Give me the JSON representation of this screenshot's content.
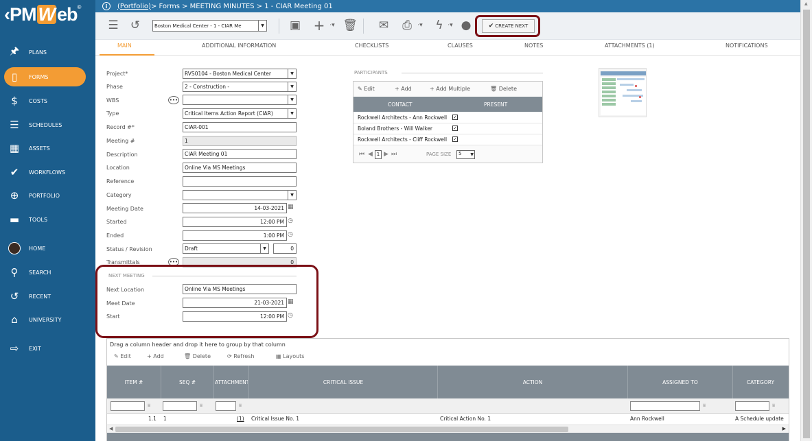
{
  "logo": {
    "text_pm": "PM",
    "text_w": "W",
    "text_eb": "eb",
    "reg": "®"
  },
  "sidebar": {
    "items": [
      {
        "label": "PLANS",
        "icon": "plans-icon",
        "glyph": "🖈"
      },
      {
        "label": "FORMS",
        "icon": "forms-icon",
        "glyph": "▯"
      },
      {
        "label": "COSTS",
        "icon": "dollar-icon",
        "glyph": "$"
      },
      {
        "label": "SCHEDULES",
        "icon": "schedules-icon",
        "glyph": "☰"
      },
      {
        "label": "ASSETS",
        "icon": "assets-icon",
        "glyph": "▦"
      },
      {
        "label": "WORKFLOWS",
        "icon": "check-icon",
        "glyph": "✔"
      },
      {
        "label": "PORTFOLIO",
        "icon": "globe-icon",
        "glyph": "⊕"
      },
      {
        "label": "TOOLS",
        "icon": "toolbox-icon",
        "glyph": "▬"
      },
      {
        "label": "HOME",
        "icon": "avatar-icon",
        "glyph": ""
      },
      {
        "label": "SEARCH",
        "icon": "search-icon",
        "glyph": "⚲"
      },
      {
        "label": "RECENT",
        "icon": "history-icon",
        "glyph": "↺"
      },
      {
        "label": "UNIVERSITY",
        "icon": "graduation-cap-icon",
        "glyph": "⌂"
      },
      {
        "label": "EXIT",
        "icon": "exit-icon",
        "glyph": "⇨"
      }
    ],
    "active": "FORMS",
    "accent": "#f39c34",
    "bg": "#1b5d8c"
  },
  "breadcrumb": {
    "portfolio": "(Portfolio)",
    "rest": " > Forms > MEETING MINUTES > 1 - CIAR Meeting 01"
  },
  "toolbar": {
    "record_select": "Boston Medical Center - 1 - CIAR Me",
    "create_next": "CREATE NEXT"
  },
  "tabs": [
    "MAIN",
    "ADDITIONAL INFORMATION",
    "CHECKLISTS",
    "CLAUSES",
    "NOTES",
    "ATTACHMENTS (1)",
    "NOTIFICATIONS"
  ],
  "form": {
    "project_label": "Project*",
    "project": "RVS0104 - Boston Medical Center",
    "phase_label": "Phase",
    "phase": "2 - Construction -",
    "wbs_label": "WBS",
    "wbs": "",
    "type_label": "Type",
    "type": "Critical Items Action Report (CIAR)",
    "record_label": "Record #*",
    "record": "CIAR-001",
    "meeting_label": "Meeting #",
    "meeting": "1",
    "description_label": "Description",
    "description": "CIAR Meeting 01",
    "location_label": "Location",
    "location": "Online Via MS Meetings",
    "reference_label": "Reference",
    "reference": "",
    "category_label": "Category",
    "category": "",
    "meeting_date_label": "Meeting Date",
    "meeting_date": "14-03-2021",
    "started_label": "Started",
    "started": "12:00 PM",
    "ended_label": "Ended",
    "ended": "1:00 PM",
    "status_label": "Status / Revision",
    "status": "Draft",
    "revision": "0",
    "transmittals_label": "Transmittals",
    "transmittals": "0"
  },
  "next_meeting": {
    "heading": "NEXT MEETING",
    "location_label": "Next Location",
    "location": "Online Via MS Meetings",
    "date_label": "Meet Date",
    "date": "21-03-2021",
    "start_label": "Start",
    "start": "12:00 PM"
  },
  "participants": {
    "heading": "PARTICIPANTS",
    "buttons": {
      "edit": "Edit",
      "add": "Add",
      "add_multiple": "Add Multiple",
      "delete": "Delete"
    },
    "columns": [
      "CONTACT",
      "PRESENT"
    ],
    "rows": [
      {
        "contact": "Rockwell Architects - Ann Rockwell",
        "present": true
      },
      {
        "contact": "Boland Brothers - Will Walker",
        "present": true
      },
      {
        "contact": "Rockwell Architects - Cliff Rockwell",
        "present": true
      }
    ],
    "page": "1",
    "page_size_label": "PAGE SIZE",
    "page_size": "5"
  },
  "grid": {
    "drag_hint": "Drag a column header and drop it here to group by that column",
    "buttons": {
      "edit": "Edit",
      "add": "Add",
      "delete": "Delete",
      "refresh": "Refresh",
      "layouts": "Layouts"
    },
    "columns": [
      "ITEM #",
      "SEQ #",
      "ATTACHMENTS",
      "CRITICAL ISSUE",
      "ACTION",
      "ASSIGNED TO",
      "CATEGORY"
    ],
    "rows": [
      {
        "item": "1.1",
        "seq": "1",
        "attachments": "(1)",
        "issue": "Critical Issue No. 1",
        "action": "Critical Action No. 1",
        "assigned": "Ann Rockwell",
        "category": "A Schedule update"
      }
    ]
  }
}
